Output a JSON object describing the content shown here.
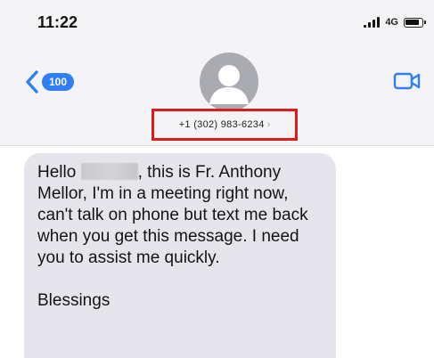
{
  "status_bar": {
    "time": "11:22",
    "network": "4G"
  },
  "header": {
    "back_count": "100",
    "contact_number": "+1 (302) 983-6234",
    "contact_chevron": "›",
    "icons": {
      "back": "chevron-left-icon",
      "avatar": "person-avatar-icon",
      "video": "video-camera-icon"
    },
    "highlight_color": "#e01b1b",
    "accent_color": "#2f7ef6"
  },
  "message": {
    "greeting": "Hello",
    "body": ", this is Fr. Anthony Mellor, I'm in a meeting right now, can't talk on phone but text me back when you get this message. I need you to assist me quickly.",
    "signoff": "Blessings"
  }
}
